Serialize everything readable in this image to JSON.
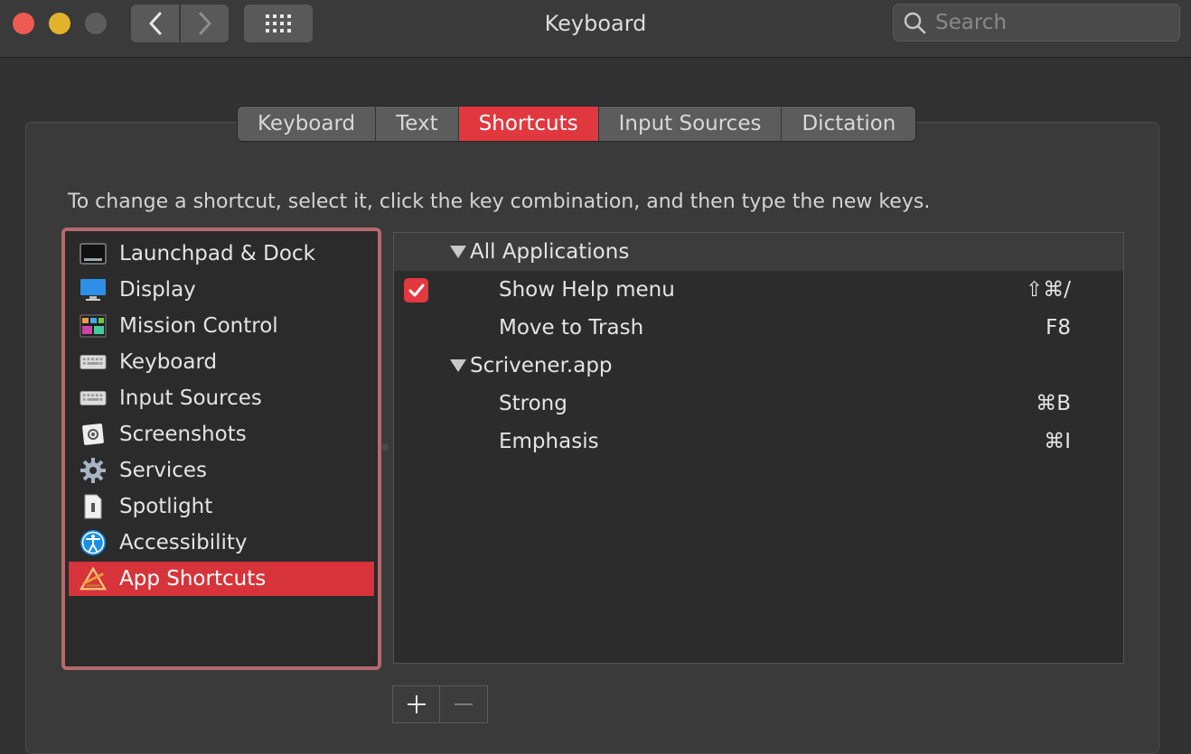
{
  "window": {
    "title": "Keyboard"
  },
  "search": {
    "placeholder": "Search"
  },
  "tabs": [
    {
      "label": "Keyboard",
      "active": false
    },
    {
      "label": "Text",
      "active": false
    },
    {
      "label": "Shortcuts",
      "active": true
    },
    {
      "label": "Input Sources",
      "active": false
    },
    {
      "label": "Dictation",
      "active": false
    }
  ],
  "instructions": "To change a shortcut, select it, click the key combination, and then type the new keys.",
  "sidebar": {
    "items": [
      {
        "label": "Launchpad & Dock",
        "icon": "launchpad-dock-icon"
      },
      {
        "label": "Display",
        "icon": "display-icon"
      },
      {
        "label": "Mission Control",
        "icon": "mission-control-icon"
      },
      {
        "label": "Keyboard",
        "icon": "keyboard-icon"
      },
      {
        "label": "Input Sources",
        "icon": "input-sources-icon"
      },
      {
        "label": "Screenshots",
        "icon": "screenshots-icon"
      },
      {
        "label": "Services",
        "icon": "gear-icon"
      },
      {
        "label": "Spotlight",
        "icon": "spotlight-icon"
      },
      {
        "label": "Accessibility",
        "icon": "accessibility-icon"
      },
      {
        "label": "App Shortcuts",
        "icon": "app-shortcuts-icon",
        "selected": true
      }
    ]
  },
  "shortcuts": {
    "groups": [
      {
        "label": "All Applications",
        "items": [
          {
            "label": "Show Help menu",
            "keys": "⇧⌘/",
            "checked": true
          },
          {
            "label": "Move to Trash",
            "keys": "F8"
          }
        ]
      },
      {
        "label": "Scrivener.app",
        "items": [
          {
            "label": "Strong",
            "keys": "⌘B"
          },
          {
            "label": "Emphasis",
            "keys": "⌘I"
          }
        ]
      }
    ]
  },
  "colors": {
    "accent": "#e0383e",
    "selection_border": "#b36a6e"
  }
}
